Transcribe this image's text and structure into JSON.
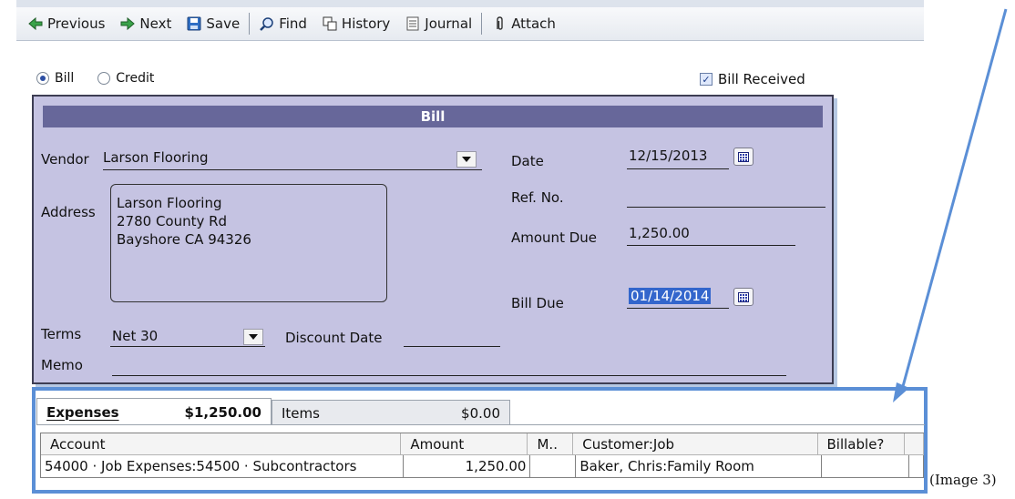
{
  "toolbar": {
    "items": [
      {
        "label": "Previous",
        "icon": "previous-icon"
      },
      {
        "label": "Next",
        "icon": "next-icon"
      },
      {
        "label": "Save",
        "icon": "save-icon"
      },
      {
        "label": "Find",
        "icon": "find-icon"
      },
      {
        "label": "History",
        "icon": "history-icon"
      },
      {
        "label": "Journal",
        "icon": "journal-icon"
      },
      {
        "label": "Attach",
        "icon": "attach-icon"
      }
    ]
  },
  "type_selector": {
    "bill": "Bill",
    "credit": "Credit",
    "selected": "Bill"
  },
  "bill_received": {
    "label": "Bill Received",
    "checked": true
  },
  "form": {
    "header": "Bill",
    "vendor_label": "Vendor",
    "vendor_value": "Larson Flooring",
    "address_label": "Address",
    "address_lines": [
      "Larson Flooring",
      "2780 County Rd",
      "Bayshore CA 94326"
    ],
    "date_label": "Date",
    "date_value": "12/15/2013",
    "ref_label": "Ref. No.",
    "ref_value": "",
    "amount_due_label": "Amount Due",
    "amount_due_value": "1,250.00",
    "bill_due_label": "Bill Due",
    "bill_due_value": "01/14/2014",
    "terms_label": "Terms",
    "terms_value": "Net 30",
    "discount_label": "Discount Date",
    "memo_label": "Memo"
  },
  "tabs": [
    {
      "label": "Expenses",
      "amount": "$1,250.00",
      "active": true
    },
    {
      "label": "Items",
      "amount": "$0.00",
      "active": false
    }
  ],
  "grid": {
    "columns": [
      "Account",
      "Amount",
      "M..",
      "Customer:Job",
      "Billable?",
      ""
    ],
    "rows": [
      {
        "account": "54000 · Job Expenses:54500 · Subcontractors",
        "amount": "1,250.00",
        "memo": "",
        "customer_job": "Baker, Chris:Family Room",
        "billable": ""
      }
    ]
  },
  "image_label": "(Image 3)",
  "colors": {
    "panel": "#c5c3e2",
    "header": "#67679a",
    "highlight": "#5b8fd6",
    "selection": "#3366cc"
  }
}
